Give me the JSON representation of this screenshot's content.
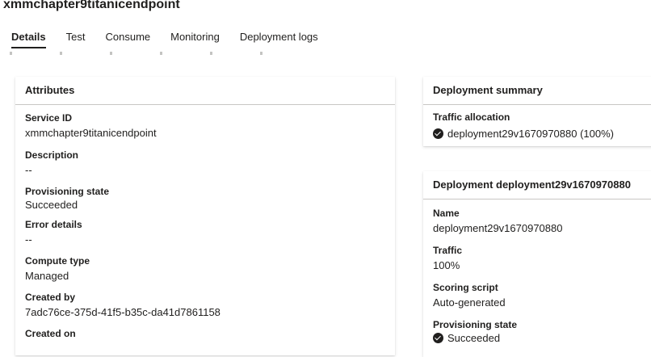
{
  "endpoint": {
    "title": "xmmchapter9titanicendpoint"
  },
  "tabs": [
    {
      "label": "Details",
      "active": true
    },
    {
      "label": "Test"
    },
    {
      "label": "Consume"
    },
    {
      "label": "Monitoring"
    },
    {
      "label": "Deployment logs"
    }
  ],
  "attributes": {
    "header": "Attributes",
    "fields": [
      {
        "label": "Service ID",
        "value": "xmmchapter9titanicendpoint"
      },
      {
        "label": "Description",
        "value": "--"
      },
      {
        "label": "Provisioning state",
        "value": "Succeeded"
      },
      {
        "label": "Error details",
        "value": "--"
      },
      {
        "label": "Compute type",
        "value": "Managed"
      },
      {
        "label": "Created by",
        "value": "7adc76ce-375d-41f5-b35c-da41d7861158"
      },
      {
        "label": "Created on",
        "value": ""
      }
    ]
  },
  "deployment_summary": {
    "header": "Deployment summary",
    "traffic_label": "Traffic allocation",
    "traffic_value": "deployment29v1670970880 (100%)",
    "status_icon": "check-circle-icon"
  },
  "deployment": {
    "header": "Deployment deployment29v1670970880",
    "fields": [
      {
        "label": "Name",
        "value": "deployment29v1670970880"
      },
      {
        "label": "Traffic",
        "value": "100%"
      },
      {
        "label": "Scoring script",
        "value": "Auto-generated"
      }
    ],
    "provisioning_label": "Provisioning state",
    "provisioning_value": "Succeeded"
  }
}
